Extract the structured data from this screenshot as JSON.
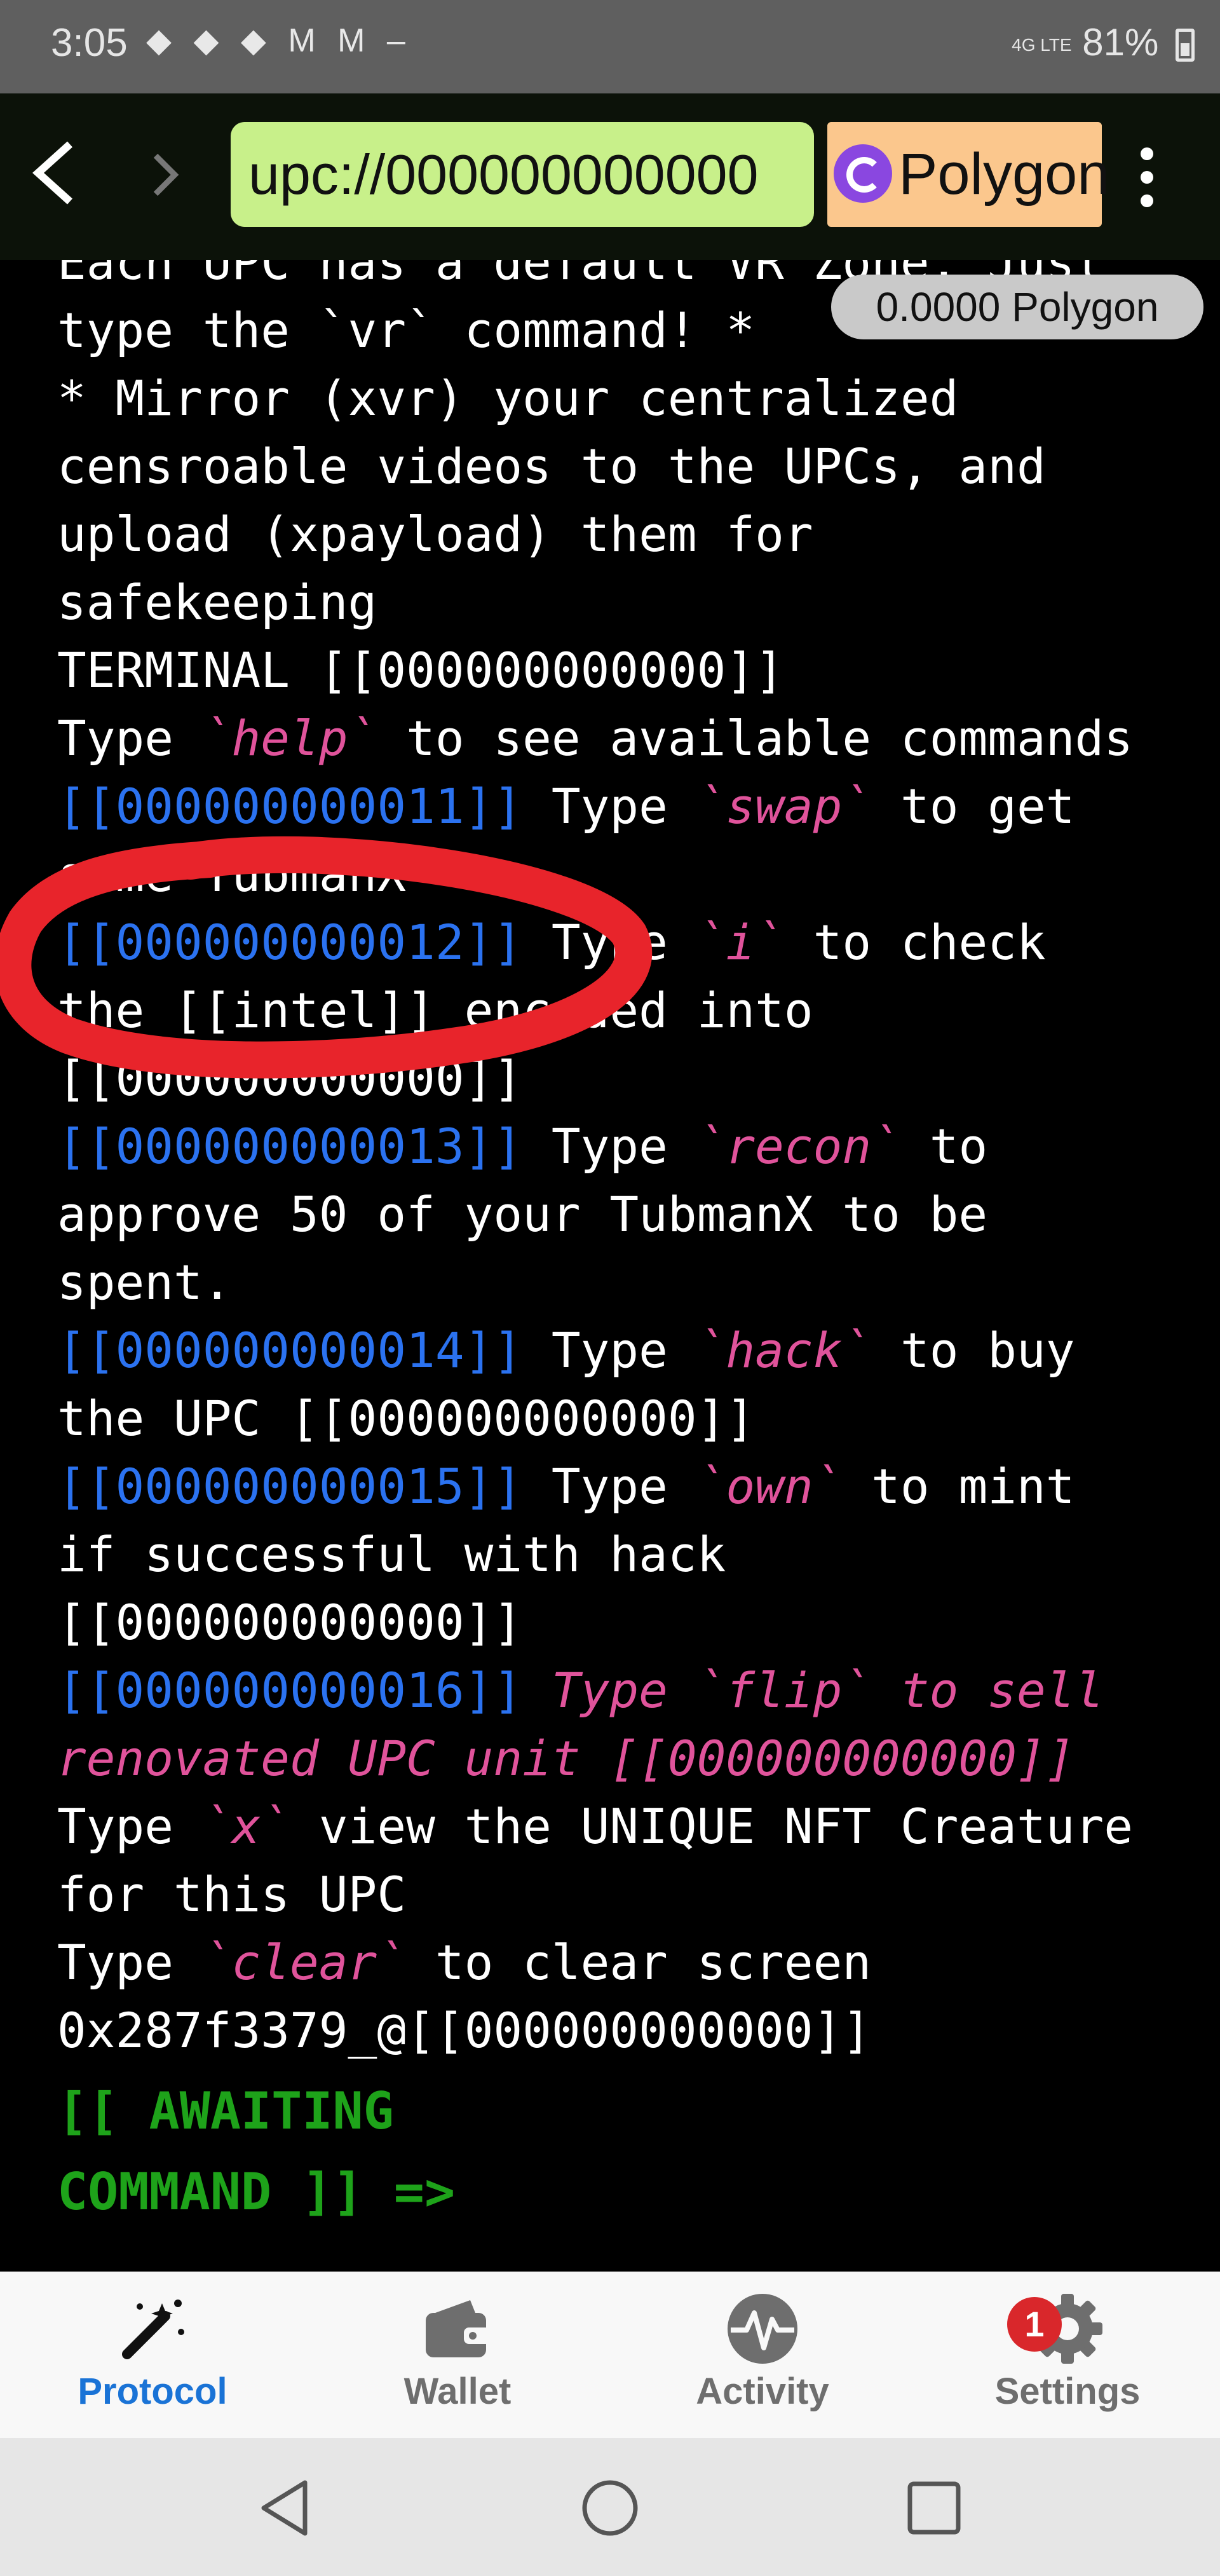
{
  "status_bar": {
    "time": "3:05",
    "icons": "◆ ◆ ◆ M M –",
    "signal": "4G LTE",
    "battery": "81%"
  },
  "browser": {
    "url": "upc://000000000000",
    "network": "Polygon",
    "balance": "0.0000 Polygon"
  },
  "terminal": {
    "lines": [
      "Each UPC has a default VR Zone. Just",
      "type the `vr` command! *",
      "* Mirror (xvr) your centralized",
      "censroable videos to the UPCs, and",
      "upload (xpayload) them for",
      "safekeeping",
      "TERMINAL [[000000000000]]"
    ],
    "help": {
      "pre": "Type ",
      "cmd": "`help`",
      "post": " to see available commands"
    },
    "steps": [
      {
        "ref": "[[000000000011]]",
        "pre": " Type ",
        "cmd": "`swap`",
        "post": " to get",
        "cont": [
          "some TubmanX"
        ]
      },
      {
        "ref": "[[000000000012]]",
        "pre": " Type ",
        "cmd": "`i`",
        "post": " to check",
        "cont": [
          "the [[intel]] encoded into",
          "[[000000000000]]"
        ]
      },
      {
        "ref": "[[000000000013]]",
        "pre": " Type ",
        "cmd": "`recon`",
        "post": " to",
        "cont": [
          "approve 50 of your TubmanX to be",
          "spent."
        ]
      },
      {
        "ref": "[[000000000014]]",
        "pre": " Type ",
        "cmd": "`hack`",
        "post": " to buy",
        "cont": [
          "the UPC [[000000000000]]"
        ]
      },
      {
        "ref": "[[000000000015]]",
        "pre": " Type ",
        "cmd": "`own`",
        "post": " to mint",
        "cont": [
          "if successful with hack",
          "[[000000000000]]"
        ]
      }
    ],
    "flip": {
      "ref": "[[000000000016]]",
      "text": " Type `flip` to sell",
      "cont": "renovated UPC unit [[000000000000]]"
    },
    "x_line": {
      "pre": "Type ",
      "cmd": "`x`",
      "post": " view the UNIQUE NFT Creature",
      "cont": "for this UPC"
    },
    "clear_line": {
      "pre": "Type ",
      "cmd": "`clear`",
      "post": " to clear screen"
    },
    "address": "0x287f3379_@[[000000000000]]",
    "prompt_1": "[[ AWAITING",
    "prompt_2": "COMMAND ]] =>"
  },
  "tabs": [
    {
      "label": "Protocol",
      "icon": "magic-wand-icon",
      "active": true
    },
    {
      "label": "Wallet",
      "icon": "wallet-icon",
      "active": false
    },
    {
      "label": "Activity",
      "icon": "activity-icon",
      "active": false
    },
    {
      "label": "Settings",
      "icon": "gear-icon",
      "active": false
    }
  ],
  "settings_badge": "1",
  "colors": {
    "url_bg": "#c8f08a",
    "network_bg": "#fbc78d",
    "command": "#e0539b",
    "reference": "#2b72f0",
    "prompt": "#1ea31a",
    "active_tab": "#1a73d6",
    "annotation": "#e8242b"
  }
}
